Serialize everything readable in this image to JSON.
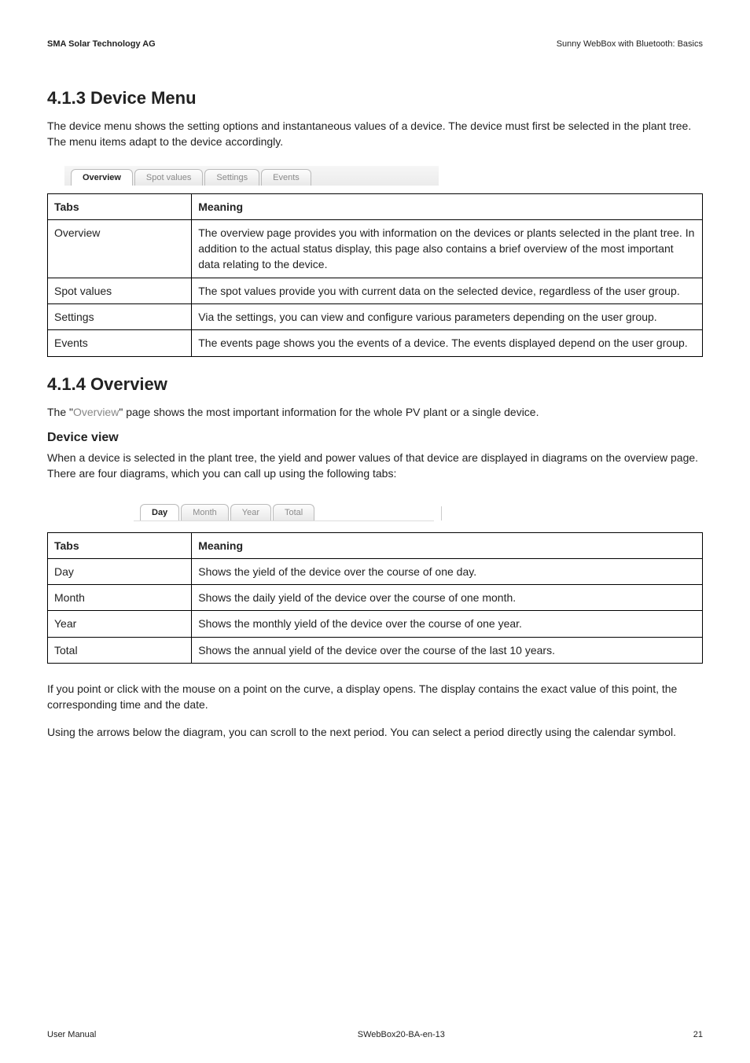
{
  "header": {
    "left": "SMA Solar Technology AG",
    "right": "Sunny WebBox with Bluetooth: Basics"
  },
  "section413": {
    "title": "4.1.3 Device Menu",
    "intro": "The device menu shows the setting options and instantaneous values of a device. The device must first be selected in the plant tree. The menu items adapt to the device accordingly.",
    "tabs": [
      "Overview",
      "Spot values",
      "Settings",
      "Events"
    ],
    "table_headers": [
      "Tabs",
      "Meaning"
    ],
    "rows": [
      {
        "c1": "Overview",
        "c2": "The overview page provides you with information on the devices or plants selected in the plant tree. In addition to the actual status display, this page also contains a brief overview of the most important data relating to the device."
      },
      {
        "c1": "Spot values",
        "c2": "The spot values provide you with current data on the selected device, regardless of the user group."
      },
      {
        "c1": "Settings",
        "c2": "Via the settings, you can view and configure various parameters depending on the user group."
      },
      {
        "c1": "Events",
        "c2": "The events page shows you the events of a device. The events displayed depend on the user group."
      }
    ]
  },
  "section414": {
    "title": "4.1.4 Overview",
    "intro_pre": "The \"",
    "intro_grey": "Overview",
    "intro_post": "\" page shows the most important information for the whole PV plant or a single device.",
    "subhead": "Device view",
    "subintro": "When a device is selected in the plant tree, the yield and power values of that device are displayed in diagrams on the overview page. There are four diagrams, which you can call up using the following tabs:",
    "tabs2": [
      "Day",
      "Month",
      "Year",
      "Total"
    ],
    "table_headers": [
      "Tabs",
      "Meaning"
    ],
    "rows": [
      {
        "c1": "Day",
        "c2": "Shows the yield of the device over the course of one day."
      },
      {
        "c1": "Month",
        "c2": "Shows the daily yield of the device over the course of one month."
      },
      {
        "c1": "Year",
        "c2": "Shows the monthly yield of the device over the course of one year."
      },
      {
        "c1": "Total",
        "c2": "Shows the annual yield of the device over the course of the last 10 years."
      }
    ],
    "para_after1": "If you point or click with the mouse on a point on the curve, a display opens. The display contains the exact value of this point, the corresponding time and the date.",
    "para_after2": "Using the arrows below the diagram, you can scroll to the next period. You can select a period directly using the calendar symbol."
  },
  "footer": {
    "left": "User Manual",
    "center": "SWebBox20-BA-en-13",
    "right": "21"
  }
}
